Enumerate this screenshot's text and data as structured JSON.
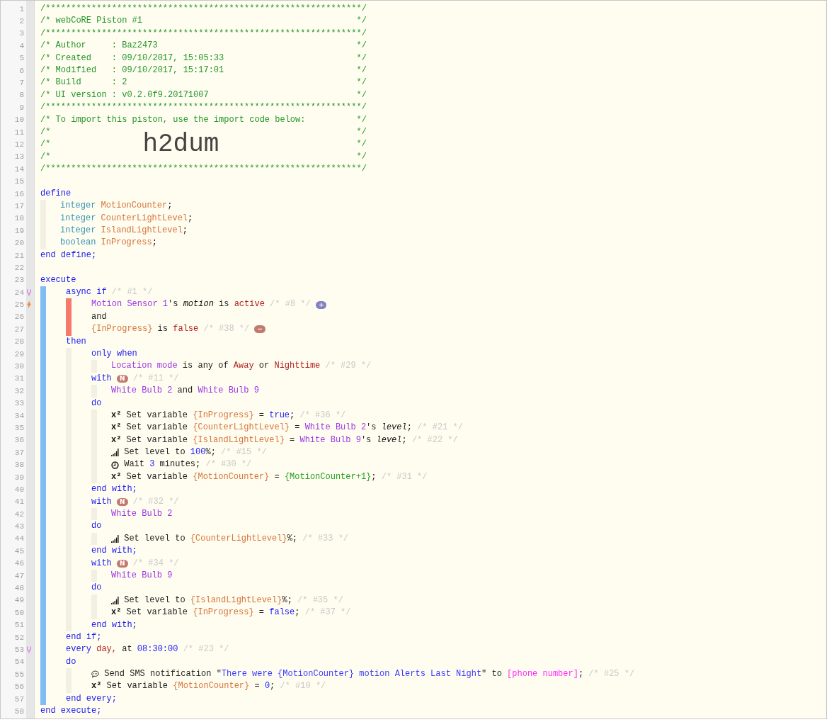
{
  "lines": [
    {
      "number": "1",
      "tokens": [
        {
          "kind": "comment",
          "text": "/**************************************************************/"
        }
      ]
    },
    {
      "number": "2",
      "tokens": [
        {
          "kind": "comment",
          "text": "/* webCoRE Piston #1"
        },
        {
          "kind": "comment-end",
          "text": "*/"
        }
      ]
    },
    {
      "number": "3",
      "tokens": [
        {
          "kind": "comment",
          "text": "/**************************************************************/"
        }
      ]
    },
    {
      "number": "4",
      "tokens": [
        {
          "kind": "comment",
          "text": "/* Author     : Baz2473"
        },
        {
          "kind": "comment-end",
          "text": "*/"
        }
      ]
    },
    {
      "number": "5",
      "tokens": [
        {
          "kind": "comment",
          "text": "/* Created    : 09/10/2017, 15:05:33"
        },
        {
          "kind": "comment-end",
          "text": "*/"
        }
      ]
    },
    {
      "number": "6",
      "tokens": [
        {
          "kind": "comment",
          "text": "/* Modified   : 09/10/2017, 15:17:01"
        },
        {
          "kind": "comment-end",
          "text": "*/"
        }
      ]
    },
    {
      "number": "7",
      "tokens": [
        {
          "kind": "comment",
          "text": "/* Build      : 2"
        },
        {
          "kind": "comment-end",
          "text": "*/"
        }
      ]
    },
    {
      "number": "8",
      "tokens": [
        {
          "kind": "comment",
          "text": "/* UI version : v0.2.0f9.20171007"
        },
        {
          "kind": "comment-end",
          "text": "*/"
        }
      ]
    },
    {
      "number": "9",
      "tokens": [
        {
          "kind": "comment",
          "text": "/**************************************************************/"
        }
      ]
    },
    {
      "number": "10",
      "tokens": [
        {
          "kind": "comment",
          "text": "/* To import this piston, use the import code below:"
        },
        {
          "kind": "comment-end",
          "text": "*/"
        }
      ]
    },
    {
      "number": "11",
      "tokens": [
        {
          "kind": "comment",
          "text": "/*"
        },
        {
          "kind": "comment-end",
          "text": "*/"
        }
      ]
    },
    {
      "number": "12",
      "tokens": [
        {
          "kind": "comment",
          "text": "/*"
        },
        {
          "kind": "import-code",
          "text": "h2dum"
        },
        {
          "kind": "comment-end",
          "text": "*/"
        }
      ]
    },
    {
      "number": "13",
      "tokens": [
        {
          "kind": "comment",
          "text": "/*"
        },
        {
          "kind": "comment-end",
          "text": "*/"
        }
      ]
    },
    {
      "number": "14",
      "tokens": [
        {
          "kind": "comment",
          "text": "/**************************************************************/"
        }
      ]
    },
    {
      "number": "15"
    },
    {
      "number": "16",
      "tokens": [
        {
          "kind": "keyword",
          "text": "define"
        }
      ],
      "kind": "body",
      "children": [
        {
          "number": "17",
          "tokens": [
            {
              "kind": "type",
              "text": "integer "
            },
            {
              "kind": "variable",
              "text": "MotionCounter"
            },
            {
              "kind": "plain",
              "text": ";"
            }
          ]
        },
        {
          "number": "18",
          "tokens": [
            {
              "kind": "type",
              "text": "integer "
            },
            {
              "kind": "variable",
              "text": "CounterLightLevel"
            },
            {
              "kind": "plain",
              "text": ";"
            }
          ]
        },
        {
          "number": "19",
          "tokens": [
            {
              "kind": "type",
              "text": "integer "
            },
            {
              "kind": "variable",
              "text": "IslandLightLevel"
            },
            {
              "kind": "plain",
              "text": ";"
            }
          ]
        },
        {
          "number": "20",
          "tokens": [
            {
              "kind": "type",
              "text": "boolean "
            },
            {
              "kind": "variable",
              "text": "InProgress"
            },
            {
              "kind": "plain",
              "text": ";"
            }
          ]
        }
      ]
    },
    {
      "number": "21",
      "tokens": [
        {
          "kind": "keyword",
          "text": "end define;"
        }
      ]
    },
    {
      "number": "22"
    },
    {
      "number": "23",
      "tokens": [
        {
          "kind": "keyword",
          "text": "execute"
        }
      ],
      "kind": "execute",
      "children": [
        {
          "number": "24",
          "marker": {
            "kind": "fork"
          },
          "tokens": [
            {
              "kind": "keyword",
              "text": "async if"
            },
            {
              "kind": "note",
              "text": " /* #1 */"
            }
          ],
          "kind": "condition",
          "children": [
            {
              "number": "25",
              "marker": {
                "kind": "bolt"
              },
              "tokens": [
                {
                  "kind": "device",
                  "text": "Motion Sensor 1"
                },
                {
                  "kind": "plain",
                  "text": "'s "
                },
                {
                  "kind": "attribute",
                  "text": "motion"
                },
                {
                  "kind": "plain",
                  "text": " is "
                },
                {
                  "kind": "value",
                  "text": "active"
                },
                {
                  "kind": "note",
                  "text": " /* #8 */ "
                },
                {
                  "kind": "badge",
                  "text": "+",
                  "color": "#8383c4"
                }
              ]
            },
            {
              "number": "26",
              "tokens": [
                {
                  "kind": "plain",
                  "text": "and"
                }
              ]
            },
            {
              "number": "27",
              "tokens": [
                {
                  "kind": "variable",
                  "text": "{InProgress}"
                },
                {
                  "kind": "plain",
                  "text": " is "
                },
                {
                  "kind": "value",
                  "text": "false"
                },
                {
                  "kind": "note",
                  "text": " /* #38 */ "
                },
                {
                  "kind": "badge",
                  "text": "−",
                  "color": "#c27a70"
                }
              ]
            }
          ]
        },
        {
          "number": "28",
          "tokens": [
            {
              "kind": "keyword",
              "text": "then"
            }
          ],
          "kind": "block",
          "children": [
            {
              "number": "29",
              "tokens": [
                {
                  "kind": "keyword",
                  "text": "only when"
                }
              ],
              "kind": "body",
              "children": [
                {
                  "number": "30",
                  "tokens": [
                    {
                      "kind": "device",
                      "text": "Location mode"
                    },
                    {
                      "kind": "plain",
                      "text": " is any of "
                    },
                    {
                      "kind": "value",
                      "text": "Away"
                    },
                    {
                      "kind": "plain",
                      "text": " or "
                    },
                    {
                      "kind": "value",
                      "text": "Nighttime"
                    },
                    {
                      "kind": "note",
                      "text": " /* #29 */"
                    }
                  ]
                }
              ]
            },
            {
              "number": "31",
              "tokens": [
                {
                  "kind": "keyword",
                  "text": "with "
                },
                {
                  "kind": "badge",
                  "text": "N",
                  "color": "#c27a70"
                },
                {
                  "kind": "note",
                  "text": " /* #11 */"
                }
              ],
              "kind": "body",
              "children": [
                {
                  "number": "32",
                  "tokens": [
                    {
                      "kind": "device",
                      "text": "White Bulb 2"
                    },
                    {
                      "kind": "plain",
                      "text": " and "
                    },
                    {
                      "kind": "device",
                      "text": "White Bulb 9"
                    }
                  ]
                }
              ]
            },
            {
              "number": "33",
              "tokens": [
                {
                  "kind": "keyword",
                  "text": "do"
                }
              ],
              "kind": "body",
              "children": [
                {
                  "number": "34",
                  "tokens": [
                    {
                      "kind": "operator",
                      "text": "x²"
                    },
                    {
                      "kind": "plain",
                      "text": " Set variable "
                    },
                    {
                      "kind": "variable",
                      "text": "{InProgress}"
                    },
                    {
                      "kind": "plain",
                      "text": " = "
                    },
                    {
                      "kind": "number",
                      "text": "true"
                    },
                    {
                      "kind": "plain",
                      "text": ";"
                    },
                    {
                      "kind": "note",
                      "text": " /* #36 */"
                    }
                  ]
                },
                {
                  "number": "35",
                  "tokens": [
                    {
                      "kind": "operator",
                      "text": "x²"
                    },
                    {
                      "kind": "plain",
                      "text": " Set variable "
                    },
                    {
                      "kind": "variable",
                      "text": "{CounterLightLevel}"
                    },
                    {
                      "kind": "plain",
                      "text": " = "
                    },
                    {
                      "kind": "device",
                      "text": "White Bulb 2"
                    },
                    {
                      "kind": "plain",
                      "text": "'s "
                    },
                    {
                      "kind": "attribute",
                      "text": "level"
                    },
                    {
                      "kind": "plain",
                      "text": ";"
                    },
                    {
                      "kind": "note",
                      "text": " /* #21 */"
                    }
                  ]
                },
                {
                  "number": "36",
                  "tokens": [
                    {
                      "kind": "operator",
                      "text": "x²"
                    },
                    {
                      "kind": "plain",
                      "text": " Set variable "
                    },
                    {
                      "kind": "variable",
                      "text": "{IslandLightLevel}"
                    },
                    {
                      "kind": "plain",
                      "text": " = "
                    },
                    {
                      "kind": "device",
                      "text": "White Bulb 9"
                    },
                    {
                      "kind": "plain",
                      "text": "'s "
                    },
                    {
                      "kind": "attribute",
                      "text": "level"
                    },
                    {
                      "kind": "plain",
                      "text": ";"
                    },
                    {
                      "kind": "note",
                      "text": " /* #22 */"
                    }
                  ]
                },
                {
                  "number": "37",
                  "tokens": [
                    {
                      "kind": "icon-level"
                    },
                    {
                      "kind": "plain",
                      "text": " Set level to "
                    },
                    {
                      "kind": "number",
                      "text": "100"
                    },
                    {
                      "kind": "plain",
                      "text": "%;"
                    },
                    {
                      "kind": "note",
                      "text": " /* #15 */"
                    }
                  ]
                },
                {
                  "number": "38",
                  "tokens": [
                    {
                      "kind": "icon-wait"
                    },
                    {
                      "kind": "plain",
                      "text": " Wait "
                    },
                    {
                      "kind": "number",
                      "text": "3"
                    },
                    {
                      "kind": "plain",
                      "text": " minutes;"
                    },
                    {
                      "kind": "note",
                      "text": " /* #30 */"
                    }
                  ]
                },
                {
                  "number": "39",
                  "tokens": [
                    {
                      "kind": "operator",
                      "text": "x²"
                    },
                    {
                      "kind": "plain",
                      "text": " Set variable "
                    },
                    {
                      "kind": "variable",
                      "text": "{MotionCounter}"
                    },
                    {
                      "kind": "plain",
                      "text": " = "
                    },
                    {
                      "kind": "expression",
                      "text": "{MotionCounter+1}"
                    },
                    {
                      "kind": "plain",
                      "text": ";"
                    },
                    {
                      "kind": "note",
                      "text": " /* #31 */"
                    }
                  ]
                }
              ]
            },
            {
              "number": "40",
              "tokens": [
                {
                  "kind": "keyword",
                  "text": "end with;"
                }
              ]
            },
            {
              "number": "41",
              "tokens": [
                {
                  "kind": "keyword",
                  "text": "with "
                },
                {
                  "kind": "badge",
                  "text": "N",
                  "color": "#c27a70"
                },
                {
                  "kind": "note",
                  "text": " /* #32 */"
                }
              ],
              "kind": "body",
              "children": [
                {
                  "number": "42",
                  "tokens": [
                    {
                      "kind": "device",
                      "text": "White Bulb 2"
                    }
                  ]
                }
              ]
            },
            {
              "number": "43",
              "tokens": [
                {
                  "kind": "keyword",
                  "text": "do"
                }
              ],
              "kind": "body",
              "children": [
                {
                  "number": "44",
                  "tokens": [
                    {
                      "kind": "icon-level"
                    },
                    {
                      "kind": "plain",
                      "text": " Set level to "
                    },
                    {
                      "kind": "variable",
                      "text": "{CounterLightLevel}"
                    },
                    {
                      "kind": "plain",
                      "text": "%;"
                    },
                    {
                      "kind": "note",
                      "text": " /* #33 */"
                    }
                  ]
                }
              ]
            },
            {
              "number": "45",
              "tokens": [
                {
                  "kind": "keyword",
                  "text": "end with;"
                }
              ]
            },
            {
              "number": "46",
              "tokens": [
                {
                  "kind": "keyword",
                  "text": "with "
                },
                {
                  "kind": "badge",
                  "text": "N",
                  "color": "#c27a70"
                },
                {
                  "kind": "note",
                  "text": " /* #34 */"
                }
              ],
              "kind": "body",
              "children": [
                {
                  "number": "47",
                  "tokens": [
                    {
                      "kind": "device",
                      "text": "White Bulb 9"
                    }
                  ]
                }
              ]
            },
            {
              "number": "48",
              "tokens": [
                {
                  "kind": "keyword",
                  "text": "do"
                }
              ],
              "kind": "body",
              "children": [
                {
                  "number": "49",
                  "tokens": [
                    {
                      "kind": "icon-level"
                    },
                    {
                      "kind": "plain",
                      "text": " Set level to "
                    },
                    {
                      "kind": "variable",
                      "text": "{IslandLightLevel}"
                    },
                    {
                      "kind": "plain",
                      "text": "%;"
                    },
                    {
                      "kind": "note",
                      "text": " /* #35 */"
                    }
                  ]
                },
                {
                  "number": "50",
                  "tokens": [
                    {
                      "kind": "operator",
                      "text": "x²"
                    },
                    {
                      "kind": "plain",
                      "text": " Set variable "
                    },
                    {
                      "kind": "variable",
                      "text": "{InProgress}"
                    },
                    {
                      "kind": "plain",
                      "text": " = "
                    },
                    {
                      "kind": "number",
                      "text": "false"
                    },
                    {
                      "kind": "plain",
                      "text": ";"
                    },
                    {
                      "kind": "note",
                      "text": " /* #37 */"
                    }
                  ]
                }
              ]
            },
            {
              "number": "51",
              "tokens": [
                {
                  "kind": "keyword",
                  "text": "end with;"
                }
              ]
            }
          ]
        },
        {
          "number": "52",
          "tokens": [
            {
              "kind": "keyword",
              "text": "end if;"
            }
          ]
        },
        {
          "number": "53",
          "marker": {
            "kind": "fork"
          },
          "tokens": [
            {
              "kind": "keyword",
              "text": "every "
            },
            {
              "kind": "value",
              "text": "day,"
            },
            {
              "kind": "plain",
              "text": " at "
            },
            {
              "kind": "number",
              "text": "08:30:00"
            },
            {
              "kind": "note",
              "text": " /* #23 */"
            }
          ]
        },
        {
          "number": "54",
          "tokens": [
            {
              "kind": "keyword",
              "text": "do"
            }
          ],
          "kind": "block",
          "children": [
            {
              "number": "55",
              "tokens": [
                {
                  "kind": "icon-message"
                },
                {
                  "kind": "plain",
                  "text": " Send SMS notification \""
                },
                {
                  "kind": "string",
                  "text": "There were {MotionCounter} motion Alerts Last Night"
                },
                {
                  "kind": "plain",
                  "text": "\" to "
                },
                {
                  "kind": "contact",
                  "text": "[phone number]"
                },
                {
                  "kind": "plain",
                  "text": ";"
                },
                {
                  "kind": "note",
                  "text": " /* #25 */"
                }
              ]
            },
            {
              "number": "56",
              "tokens": [
                {
                  "kind": "operator",
                  "text": "x²"
                },
                {
                  "kind": "plain",
                  "text": " Set variable "
                },
                {
                  "kind": "variable",
                  "text": "{MotionCounter}"
                },
                {
                  "kind": "plain",
                  "text": " = "
                },
                {
                  "kind": "number",
                  "text": "0"
                },
                {
                  "kind": "plain",
                  "text": ";"
                },
                {
                  "kind": "note",
                  "text": " /* #10 */"
                }
              ]
            }
          ]
        },
        {
          "number": "57",
          "tokens": [
            {
              "kind": "keyword",
              "text": "end every;"
            }
          ]
        }
      ]
    },
    {
      "number": "58",
      "tokens": [
        {
          "kind": "keyword",
          "text": "end execute;"
        }
      ]
    }
  ]
}
